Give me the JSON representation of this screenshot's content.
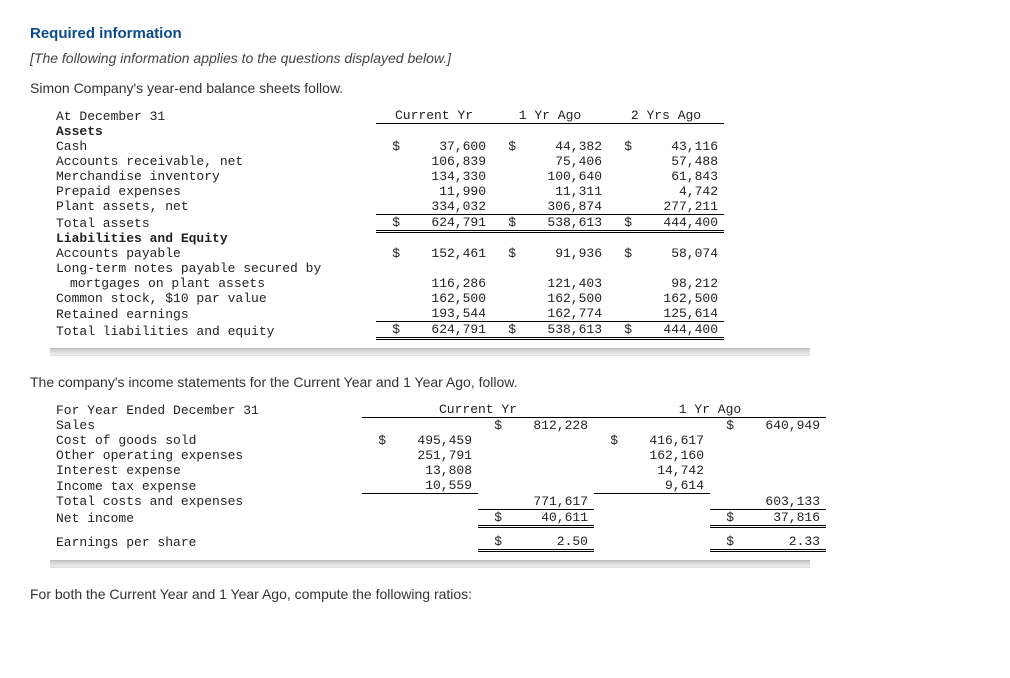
{
  "header": {
    "required": "Required information",
    "note": "[The following information applies to the questions displayed below.]",
    "intro": "Simon Company's year-end balance sheets follow."
  },
  "bs": {
    "h_date": "At December 31",
    "h_c": "Current Yr",
    "h_1": "1 Yr Ago",
    "h_2": "2 Yrs Ago",
    "assets_hdr": "Assets",
    "rows": {
      "cash": {
        "l": "Cash",
        "c": "37,600",
        "y1": "44,382",
        "y2": "43,116"
      },
      "ar": {
        "l": "Accounts receivable, net",
        "c": "106,839",
        "y1": "75,406",
        "y2": "57,488"
      },
      "inv": {
        "l": "Merchandise inventory",
        "c": "134,330",
        "y1": "100,640",
        "y2": "61,843"
      },
      "pre": {
        "l": "Prepaid expenses",
        "c": "11,990",
        "y1": "11,311",
        "y2": "4,742"
      },
      "plant": {
        "l": "Plant assets, net",
        "c": "334,032",
        "y1": "306,874",
        "y2": "277,211"
      },
      "ta": {
        "l": "Total assets",
        "c": "624,791",
        "y1": "538,613",
        "y2": "444,400"
      }
    },
    "liab_hdr": "Liabilities and Equity",
    "lrows": {
      "ap": {
        "l": "Accounts payable",
        "c": "152,461",
        "y1": "91,936",
        "y2": "58,074"
      },
      "ltn1": {
        "l": "Long-term notes payable secured by"
      },
      "ltn2": {
        "l": "mortgages on plant assets",
        "c": "116,286",
        "y1": "121,403",
        "y2": "98,212"
      },
      "cs": {
        "l": "Common stock, $10 par value",
        "c": "162,500",
        "y1": "162,500",
        "y2": "162,500"
      },
      "re": {
        "l": "Retained earnings",
        "c": "193,544",
        "y1": "162,774",
        "y2": "125,614"
      },
      "tle": {
        "l": "Total liabilities and equity",
        "c": "624,791",
        "y1": "538,613",
        "y2": "444,400"
      }
    }
  },
  "is_intro": "The company's income statements for the Current Year and 1 Year Ago, follow.",
  "is": {
    "h_date": "For Year Ended December 31",
    "h_c": "Current Yr",
    "h_1": "1 Yr Ago",
    "sales": {
      "l": "Sales",
      "c": "812,228",
      "y1": "640,949"
    },
    "cogs": {
      "l": "Cost of goods sold",
      "c": "495,459",
      "y1": "416,617"
    },
    "ooe": {
      "l": "Other operating expenses",
      "c": "251,791",
      "y1": "162,160"
    },
    "int": {
      "l": "Interest expense",
      "c": "13,808",
      "y1": "14,742"
    },
    "tax": {
      "l": "Income tax expense",
      "c": "10,559",
      "y1": "9,614"
    },
    "tce": {
      "l": "Total costs and expenses",
      "c": "771,617",
      "y1": "603,133"
    },
    "ni": {
      "l": "Net income",
      "c": "40,611",
      "y1": "37,816"
    },
    "eps": {
      "l": "Earnings per share",
      "c": "2.50",
      "y1": "2.33"
    }
  },
  "footer": "For both the Current Year and 1 Year Ago, compute the following ratios:"
}
